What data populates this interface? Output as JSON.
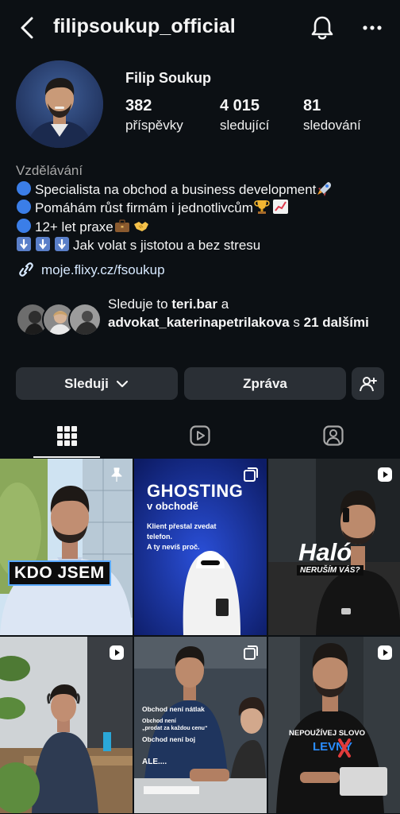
{
  "header": {
    "username": "filipsoukup_official"
  },
  "profile": {
    "full_name": "Filip Soukup",
    "stats": [
      {
        "value": "382",
        "label": "příspěvky"
      },
      {
        "value": "4 015",
        "label": "sledující"
      },
      {
        "value": "81",
        "label": "sledování"
      }
    ]
  },
  "bio": {
    "category": "Vzdělávání",
    "lines": [
      "Specialista na obchod a business development",
      "Pomáhám růst firmám i jednotlivcům",
      "12+ let praxe",
      "Jak volat s jistotou a bez stresu"
    ],
    "link": "moje.flixy.cz/fsoukup"
  },
  "followed_by": {
    "prefix": "Sleduje to ",
    "user1": "teri.bar",
    "mid": " a ",
    "user2": "advokat_katerinapetrilakova",
    "mid2": " s ",
    "others": "21 dalšími"
  },
  "actions": {
    "follow_label": "Sleduji",
    "message_label": "Zpráva"
  },
  "posts": [
    {
      "kind": "pinned",
      "overlay": "KDO JSEM"
    },
    {
      "kind": "carousel",
      "title": "GHOSTING",
      "subtitle": "v obchodě",
      "body1": "Klient přestal zvedat",
      "body2": "telefon.",
      "body3": "A ty nevíš proč."
    },
    {
      "kind": "reel",
      "title": "Haló",
      "subtitle": "NERUŠÍM VÁS?"
    },
    {
      "kind": "reel"
    },
    {
      "kind": "carousel",
      "line1": "Obchod není nátlak",
      "line2": "Obchod není",
      "line3": "„prodat za každou cenu“",
      "line4": "Obchod není boj",
      "line5": "ALE...."
    },
    {
      "kind": "reel",
      "line1": "NEPOUŽÍVEJ SLOVO",
      "line2": "LEVNÝ"
    }
  ],
  "colors": {
    "background": "#0c1014",
    "button": "#2a2f35",
    "link": "#d7e9ff",
    "muted": "#a8a8a8"
  }
}
